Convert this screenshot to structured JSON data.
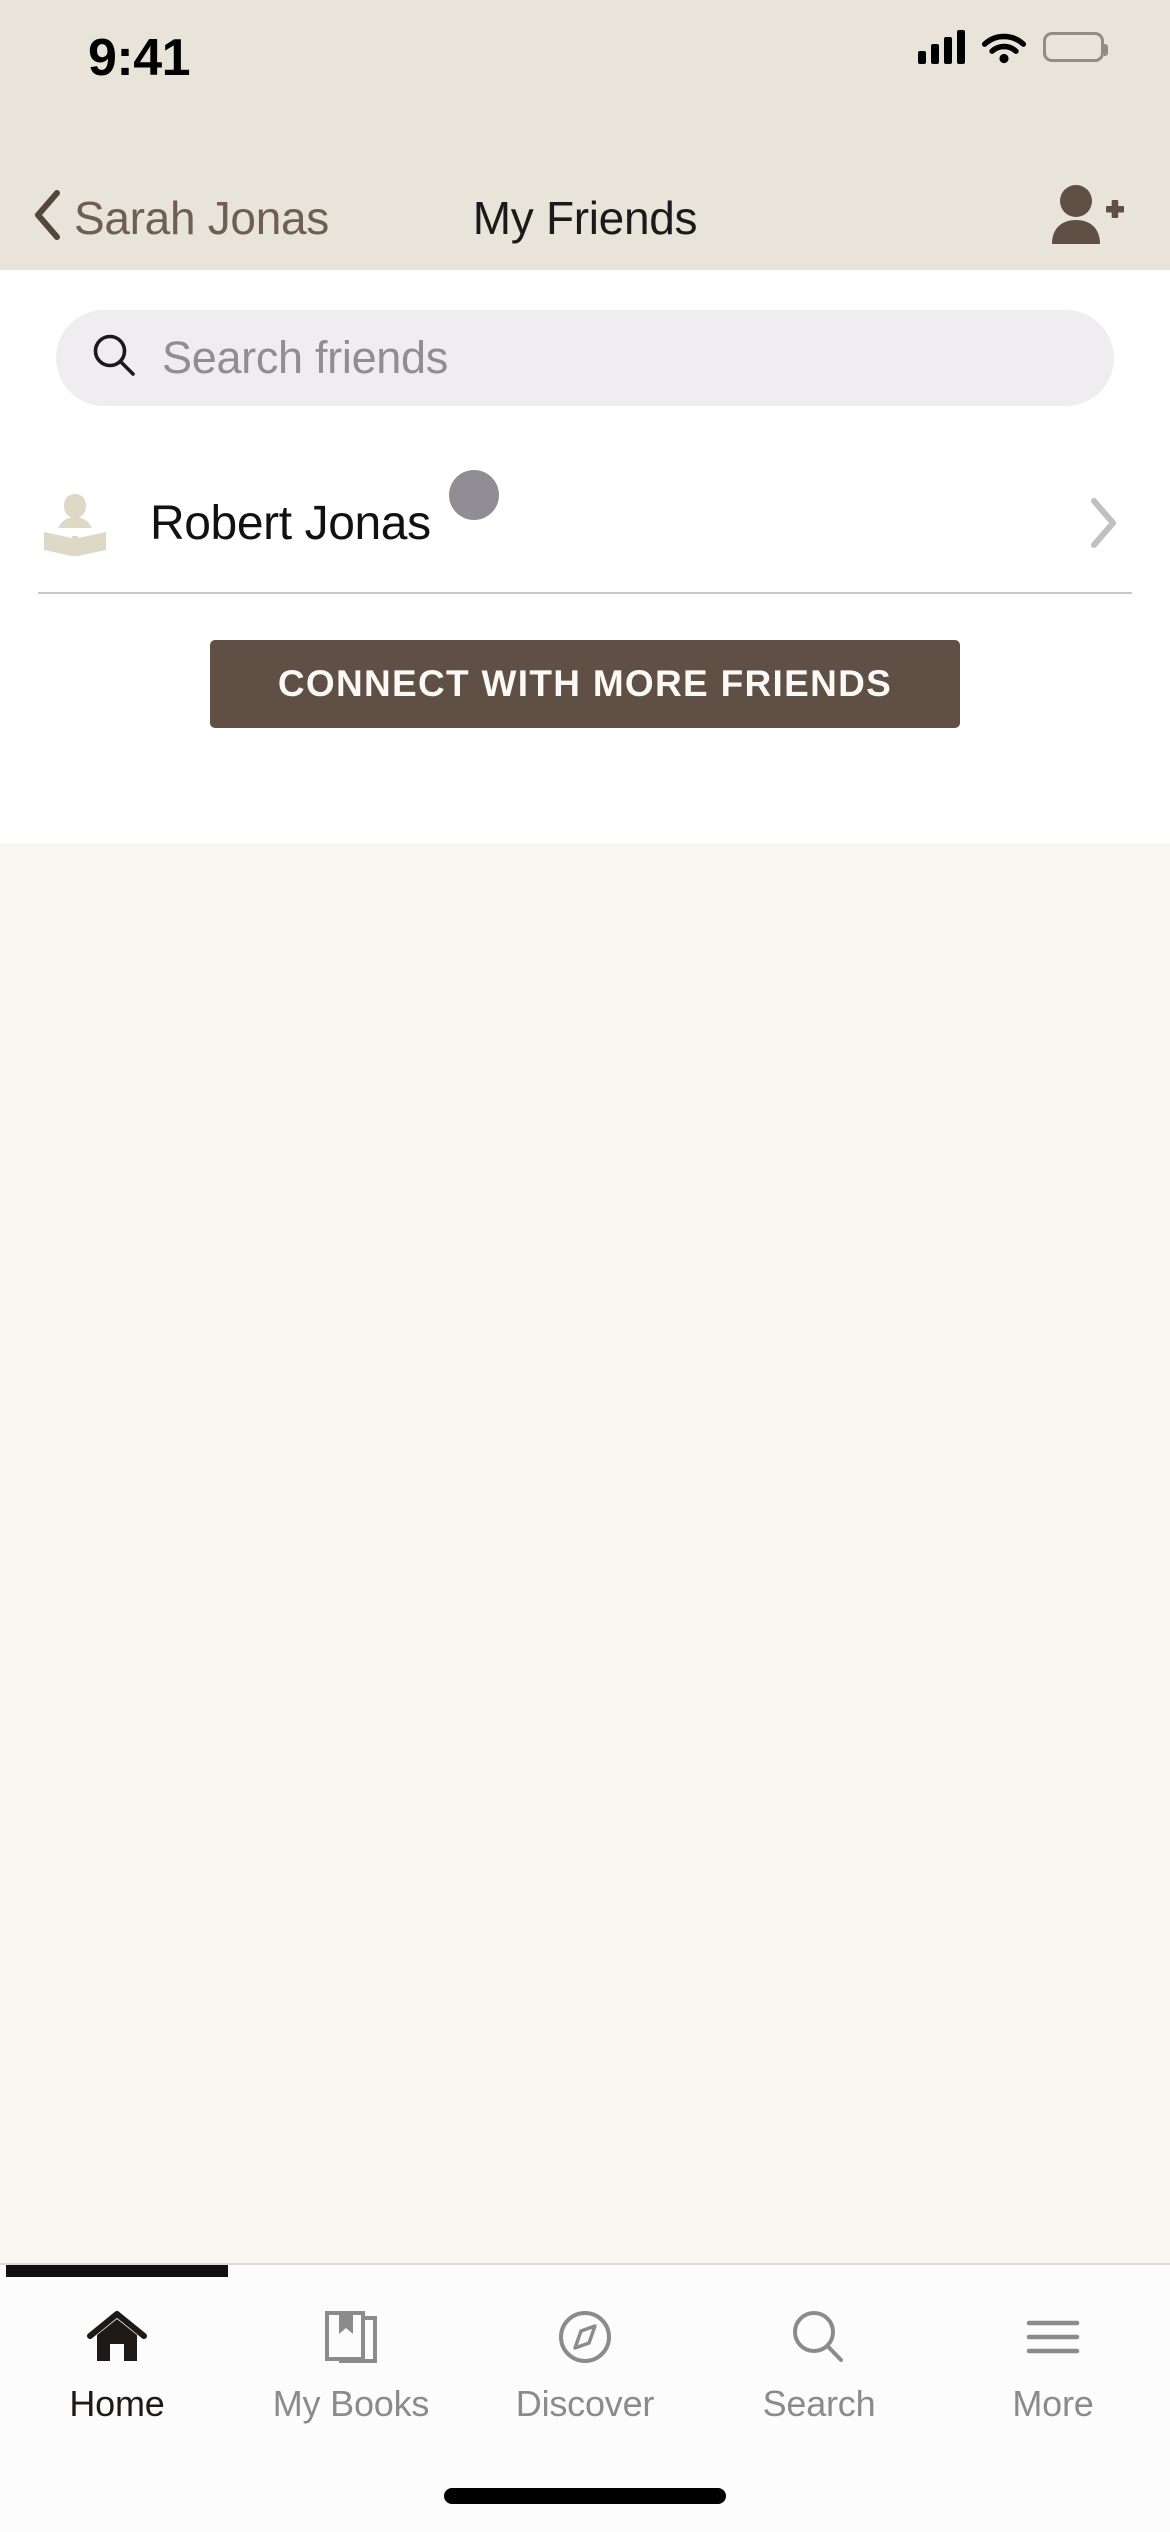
{
  "status_bar": {
    "time": "9:41",
    "signal_icon": "cellular-bars-icon",
    "wifi_icon": "wifi-icon",
    "battery_icon": "battery-full-icon"
  },
  "nav": {
    "back_icon": "chevron-left-icon",
    "back_label": "Sarah  Jonas",
    "title": "My Friends",
    "action_icon": "add-person-icon"
  },
  "search": {
    "icon": "search-icon",
    "placeholder": "Search friends",
    "value": ""
  },
  "friends": [
    {
      "avatar_icon": "person-reading-book-icon",
      "name": "Robert Jonas",
      "status_badge": "offline-dot",
      "chevron_icon": "chevron-right-icon"
    }
  ],
  "connect_button": {
    "label": "CONNECT WITH MORE FRIENDS"
  },
  "tabbar": {
    "items": [
      {
        "label": "Home",
        "icon": "home-icon",
        "active": true
      },
      {
        "label": "My Books",
        "icon": "book-bookmark-icon",
        "active": false
      },
      {
        "label": "Discover",
        "icon": "compass-icon",
        "active": false
      },
      {
        "label": "Search",
        "icon": "search-icon",
        "active": false
      },
      {
        "label": "More",
        "icon": "hamburger-menu-icon",
        "active": false
      }
    ]
  },
  "colors": {
    "header_bg": "#E8E4D9",
    "page_bg": "#F8F6F1",
    "card_bg": "#FFFFFF",
    "accent_brown": "#5F4F44",
    "back_label": "#6E5F52",
    "placeholder": "#8E8E93",
    "tab_inactive": "#8B8B8B",
    "tab_active": "#1E1A17",
    "avatar_tan": "#DED8C7",
    "badge_gray": "#908E94"
  }
}
